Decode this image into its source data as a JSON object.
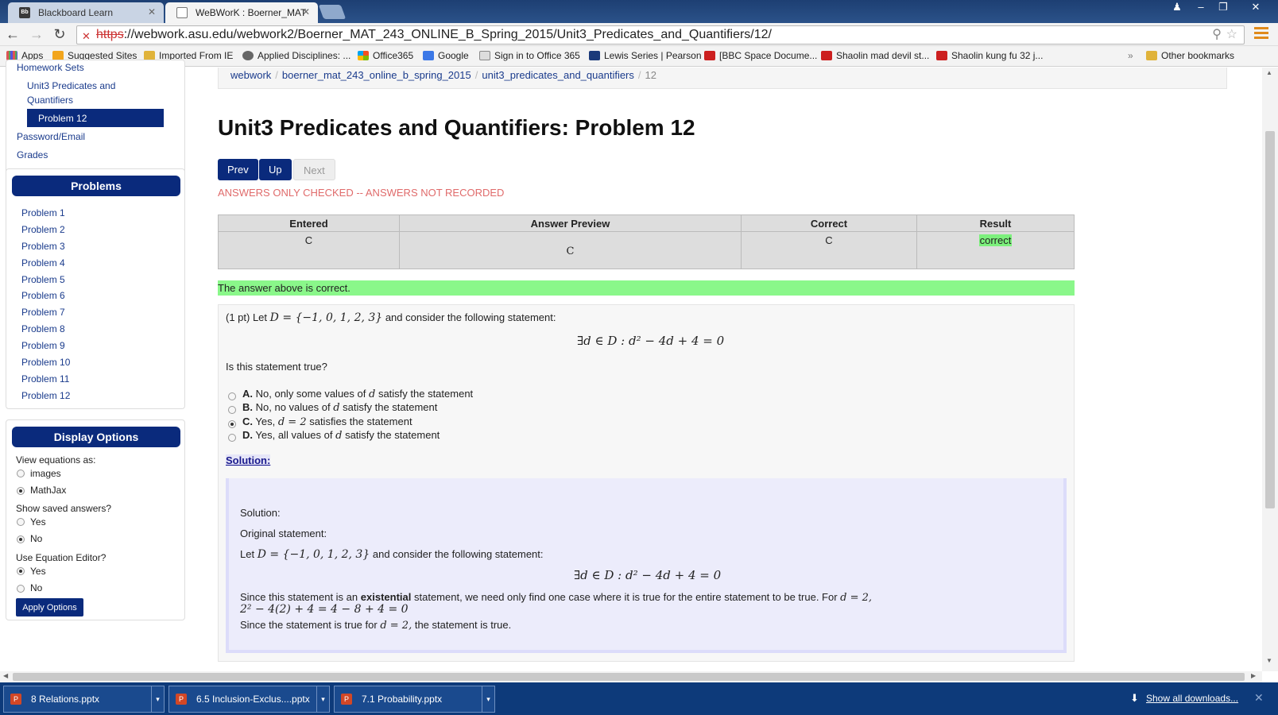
{
  "browser": {
    "tabs": [
      {
        "title": "Blackboard Learn",
        "favicon": "Bb",
        "active": false
      },
      {
        "title": "WeBWorK : Boerner_MAT",
        "active": true
      }
    ],
    "url_scheme": "https",
    "url_rest": "://webwork.asu.edu/webwork2/Boerner_MAT_243_ONLINE_B_Spring_2015/Unit3_Predicates_and_Quantifiers/12/",
    "bookmarks": [
      {
        "label": "Apps",
        "icon": "apps-grid-icon"
      },
      {
        "label": "Suggested Sites",
        "icon": "ie-icon"
      },
      {
        "label": "Imported From IE",
        "icon": "folder-icon"
      },
      {
        "label": "Applied Disciplines: ...",
        "icon": "site-icon"
      },
      {
        "label": "Office365",
        "icon": "office-icon"
      },
      {
        "label": "Google",
        "icon": "google-icon"
      },
      {
        "label": "Sign in to Office 365",
        "icon": "page-icon"
      },
      {
        "label": "Lewis Series | Pearson",
        "icon": "pearson-icon"
      },
      {
        "label": "[BBC Space Docume...",
        "icon": "youtube-icon"
      },
      {
        "label": "Shaolin mad devil st...",
        "icon": "youtube-icon"
      },
      {
        "label": "Shaolin kung fu 32 j...",
        "icon": "youtube-icon"
      },
      {
        "label": "»",
        "icon": ""
      },
      {
        "label": "Other bookmarks",
        "icon": "folder-icon"
      }
    ]
  },
  "sidebar": {
    "homework_sets_label": "Homework Sets",
    "set_link_line1": "Unit3 Predicates and",
    "set_link_line2": "Quantifiers",
    "active_problem": "Problem 12",
    "password_email": "Password/Email",
    "grades": "Grades",
    "problems_header": "Problems",
    "problems": [
      "Problem 1",
      "Problem 2",
      "Problem 3",
      "Problem 4",
      "Problem 5",
      "Problem 6",
      "Problem 7",
      "Problem 8",
      "Problem 9",
      "Problem 10",
      "Problem 11",
      "Problem 12"
    ],
    "display_options_header": "Display Options",
    "view_equations_label": "View equations as:",
    "view_equations_options": [
      "images",
      "MathJax"
    ],
    "view_equations_selected": "MathJax",
    "show_saved_label": "Show saved answers?",
    "show_saved_options": [
      "Yes",
      "No"
    ],
    "show_saved_selected": "No",
    "use_editor_label": "Use Equation Editor?",
    "use_editor_options": [
      "Yes",
      "No"
    ],
    "use_editor_selected": "Yes",
    "apply_button": "Apply Options"
  },
  "breadcrumb": [
    "webwork",
    "boerner_mat_243_online_b_spring_2015",
    "unit3_predicates_and_quantifiers",
    "12"
  ],
  "page_title": "Unit3 Predicates and Quantifiers: Problem 12",
  "nav": {
    "prev": "Prev",
    "up": "Up",
    "next": "Next"
  },
  "notice": "ANSWERS ONLY CHECKED -- ANSWERS NOT RECORDED",
  "results_table": {
    "headers": [
      "Entered",
      "Answer Preview",
      "Correct",
      "Result"
    ],
    "row": [
      "C",
      "C",
      "C",
      "correct"
    ]
  },
  "result_message": "The answer above is correct.",
  "problem": {
    "intro_pre": "(1 pt) Let",
    "set_def": "D = {−1, 0, 1, 2, 3}",
    "intro_post": "and consider the following statement:",
    "statement": "∃d ∈ D : d² − 4d + 4 = 0",
    "question": "Is this statement true?",
    "choices": [
      {
        "letter": "A.",
        "pre": "No, only some values of",
        "math": "d",
        "post": "satisfy the statement"
      },
      {
        "letter": "B.",
        "pre": "No, no values of",
        "math": "d",
        "post": "satisfy the statement"
      },
      {
        "letter": "C.",
        "pre": "Yes,",
        "math": "d = 2",
        "post": "satisfies the statement"
      },
      {
        "letter": "D.",
        "pre": "Yes, all values of",
        "math": "d",
        "post": "satisfy the statement"
      }
    ],
    "selected_choice": "C."
  },
  "solution": {
    "link": "Solution:",
    "heading": "Solution:",
    "original_label": "Original statement:",
    "let_pre": "Let",
    "set_def": "D = {−1, 0, 1, 2, 3}",
    "let_post": "and consider the following statement:",
    "statement": "∃d ∈ D : d² − 4d + 4 = 0",
    "since1_pre": "Since this statement is an",
    "since1_bold": "existential",
    "since1_post": "statement, we need only find one case where it is true for the entire statement to be true. For",
    "since1_math": "d = 2,",
    "calc": "2² − 4(2) + 4 = 4 − 8 + 4 = 0",
    "since2_pre": "Since the statement is true for",
    "since2_math": "d = 2,",
    "since2_post": "the statement is true."
  },
  "downloads": {
    "items": [
      "8 Relations.pptx",
      "6.5 Inclusion-Exclus....pptx",
      "7.1 Probability.pptx"
    ],
    "show_all": "Show all downloads..."
  },
  "colors": {
    "webwork_blue": "#0a2a7c",
    "correct_green": "#8af78a",
    "notice_red": "#e06b6b"
  }
}
